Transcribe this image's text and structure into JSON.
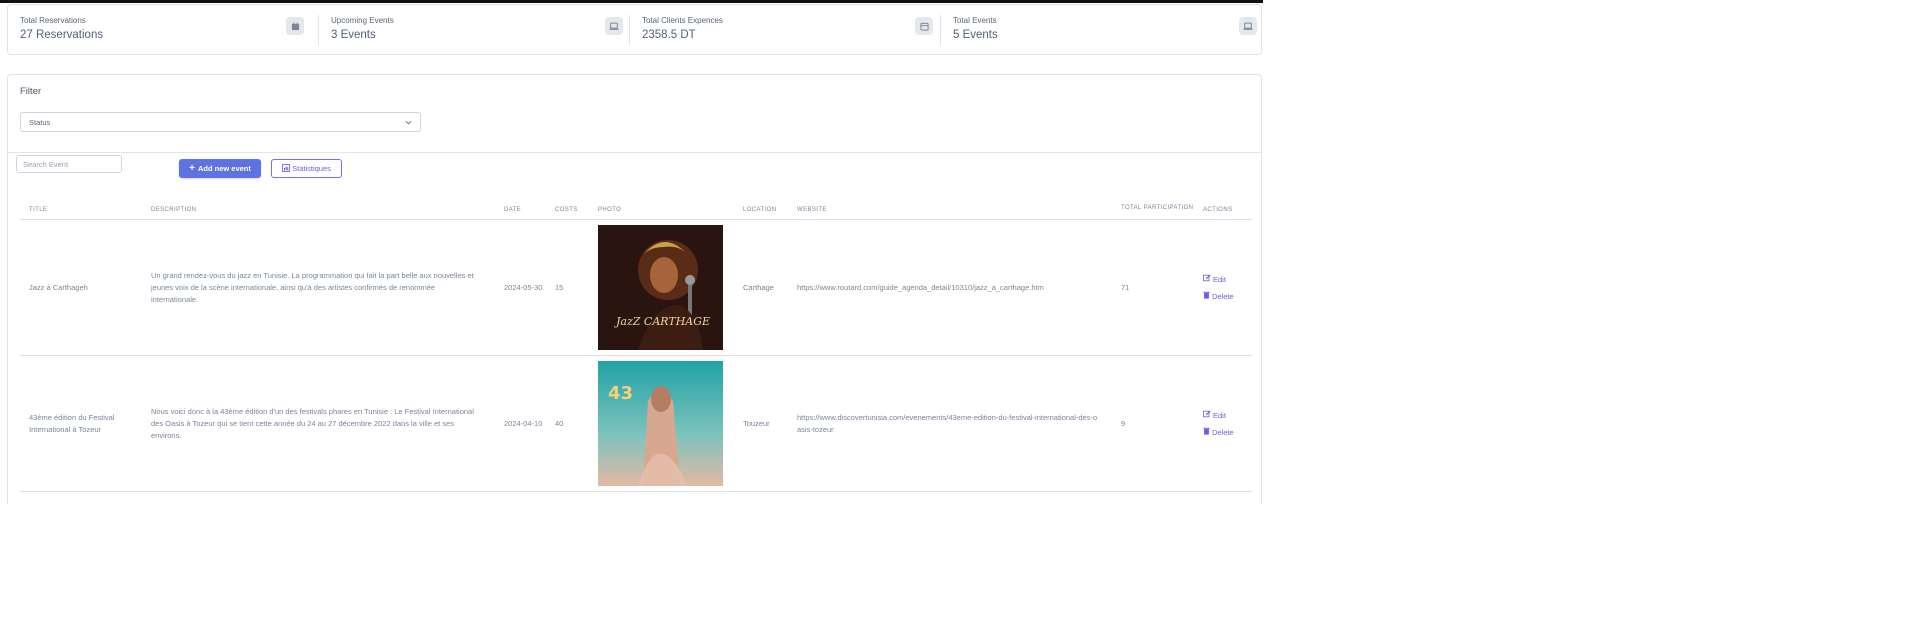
{
  "stats": [
    {
      "label": "Total Reservations",
      "value": "27 Reservations",
      "icon": "calendar-icon"
    },
    {
      "label": "Upcoming Events",
      "value": "3 Events",
      "icon": "laptop-icon"
    },
    {
      "label": "Total Clients Expences",
      "value": "2358.5 DT",
      "icon": "calendar-icon"
    },
    {
      "label": "Total Events",
      "value": "5 Events",
      "icon": "laptop-icon"
    }
  ],
  "filter": {
    "title": "Filter",
    "status_select": "Status"
  },
  "toolbar": {
    "search_placeholder": "Search Event",
    "add_label": "Add new event",
    "stats_label": "Statistiques"
  },
  "table": {
    "headers": [
      "TITLE",
      "DESCRIPTION",
      "DATE",
      "COSTS",
      "PHOTO",
      "LOCATION",
      "WEBSITE",
      "TOTAL PARTICIPATION",
      "ACTIONS"
    ],
    "rows": [
      {
        "title": "Jazz à Carthageh",
        "description": "Un grand rendez-vous du jazz en Tunisie. La programmation qui fait la part belle aux nouvelles et jeunes voix de la scène internationale, ainsi qu'à des artistes confirmés de renommée internationale.",
        "date": "2024-05-30",
        "costs": "15",
        "photo": "jazz-carthage-poster",
        "poster_text": "JazZ CARTHAGE",
        "location": "Carthage",
        "website": "https://www.routard.com/guide_agenda_detail/10310/jazz_a_carthage.htm",
        "participation": "71"
      },
      {
        "title": "43ème édition du Festival International à Tozeur",
        "description": "Nous voici donc à la 43ème édition d'un des festivals phares en Tunisie : Le Festival International des Oasis à Tozeur qui se tient cette année du 24 au 27 décembre 2022 dans la ville et ses environs.",
        "date": "2024-04-10",
        "costs": "40",
        "photo": "tozeur-festival-poster",
        "poster_text": "43",
        "location": "Touzeur",
        "website": "https://www.discovertunisia.com/evenements/43eme-edition-du-festival-international-des-oasis-tozeur",
        "participation": "9"
      }
    ],
    "edit_label": "Edit",
    "delete_label": "Delete"
  },
  "colors": {
    "primary": "#5e72e4",
    "action": "#6a5fe6",
    "text": "#67748e"
  }
}
